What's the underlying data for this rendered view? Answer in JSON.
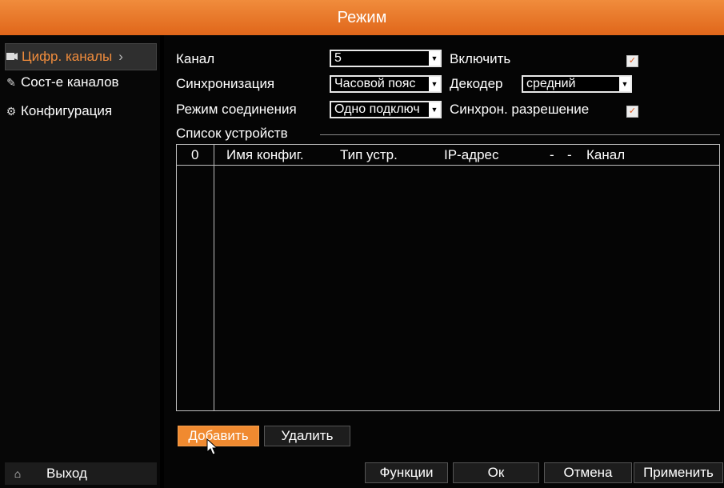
{
  "window": {
    "title": "Режим"
  },
  "sidebar": {
    "items": [
      {
        "label": "Цифр. каналы",
        "icon": "camera-icon",
        "active": true
      },
      {
        "label": "Сост-е каналов",
        "icon": "edit-icon",
        "active": false
      },
      {
        "label": "Конфигурация",
        "icon": "gear-icon",
        "active": false
      }
    ],
    "exit": {
      "label": "Выход",
      "icon": "home-icon"
    }
  },
  "form": {
    "channel": {
      "label": "Канал",
      "value": "5"
    },
    "sync": {
      "label": "Синхронизация",
      "value": "Часовой пояс"
    },
    "conn_mode": {
      "label": "Режим соединения",
      "value": "Одно подключ"
    },
    "enable": {
      "label": "Включить",
      "checked": true
    },
    "decoder": {
      "label": "Декодер",
      "value": "средний"
    },
    "sync_res": {
      "label": "Синхрон. разрешение",
      "checked": true
    }
  },
  "device_list": {
    "title": "Список устройств",
    "columns": [
      "0",
      "Имя конфиг.",
      "Тип устр.",
      "IP-адрес",
      "-",
      "-",
      "Канал"
    ],
    "rows": []
  },
  "buttons": {
    "add": "Добавить",
    "delete": "Удалить",
    "functions": "Функции",
    "ok": "Ок",
    "cancel": "Отмена",
    "apply": "Применить"
  },
  "colors": {
    "accent": "#f08c3c"
  }
}
